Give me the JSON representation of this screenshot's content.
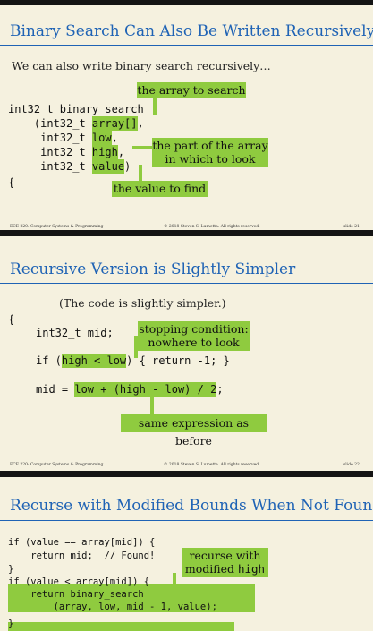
{
  "slide1": {
    "title": "Binary Search Can Also Be Written Recursively",
    "intro": "We can also write binary search recursively…",
    "code": {
      "line1": "int32_t binary_search",
      "line2a": "    (int32_t ",
      "line2b": "array[]",
      "line2c": ",",
      "line3a": "     int32_t ",
      "line3b": "low",
      "line3c": ",",
      "line4a": "     int32_t ",
      "line4b": "high",
      "line4c": ",",
      "line5a": "     int32_t ",
      "line5b": "value",
      "line5c": ")",
      "line6": "{"
    },
    "callouts": {
      "array": "the array to search",
      "part_line1": "the part of the array",
      "part_line2": "in which to look",
      "value": "the value to find"
    },
    "footer": {
      "left": "ECE 220: Computer Systems & Programming",
      "center": "© 2018 Steven S. Lumetta.  All rights reserved.",
      "right": "slide 21"
    }
  },
  "slide2": {
    "title": "Recursive Version is Slightly Simpler",
    "intro": "(The code is slightly simpler.)",
    "code": {
      "brace": "{",
      "mid": "int32_t mid;",
      "if_pre": "if (",
      "if_hl": "high < low",
      "if_post": ") { return -1; }",
      "mid_pre": "mid = ",
      "mid_hl": "low + (high - low) / 2",
      "mid_post": ";"
    },
    "callouts": {
      "stop_line1": "stopping condition:",
      "stop_line2": "nowhere to look",
      "same": "same expression as before"
    },
    "footer": {
      "left": "ECE 220: Computer Systems & Programming",
      "center": "© 2018 Steven S. Lumetta.  All rights reserved.",
      "right": "slide 22"
    }
  },
  "slide3": {
    "title": "Recurse with Modified Bounds When Not Found",
    "code": {
      "l1": "if (value == array[mid]) {",
      "l2": "    return mid;  // Found!",
      "l3": "}",
      "l4": "if (value < array[mid]) {",
      "l5": "    return binary_search",
      "l6": "        (array, low, mid - 1, value);",
      "l7": "}"
    },
    "callouts": {
      "rec_line1": "recurse with",
      "rec_line2a": "modified ",
      "rec_line2b": "high"
    }
  }
}
